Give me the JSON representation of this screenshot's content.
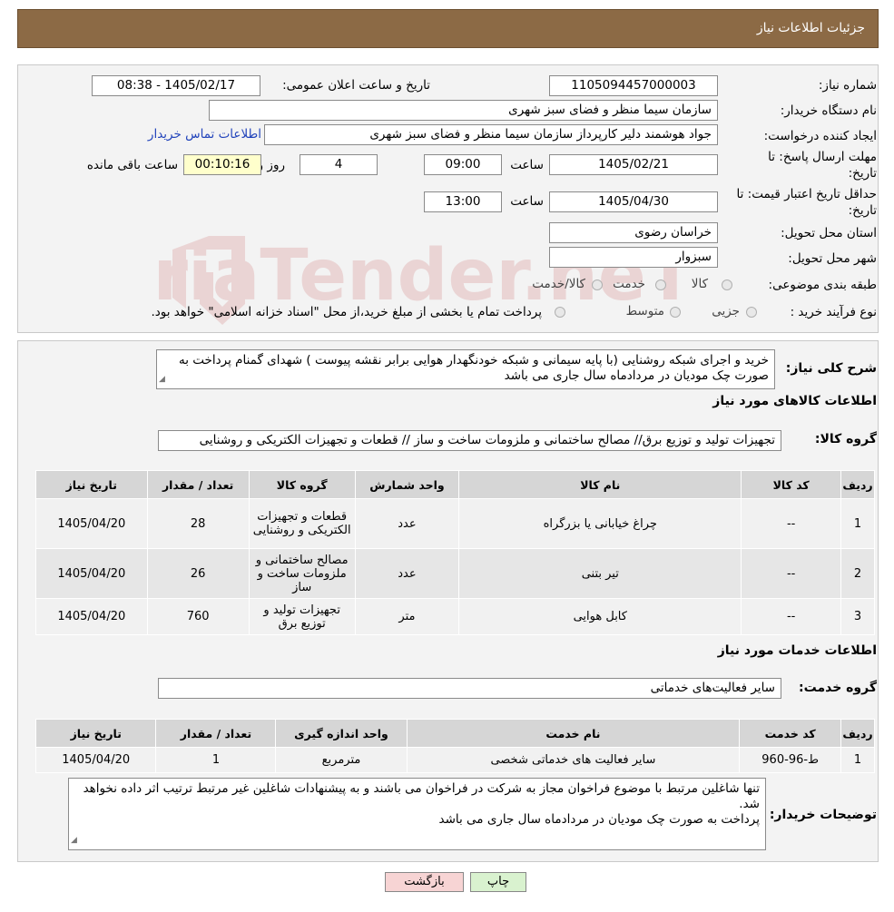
{
  "header": {
    "title": "جزئیات اطلاعات نیاز"
  },
  "info": {
    "need_number_label": "شماره نیاز:",
    "need_number": "1105094457000003",
    "announce_label": "تاریخ و ساعت اعلان عمومی:",
    "announce_value": "1405/02/17 - 08:38",
    "buyer_org_label": "نام دستگاه خریدار:",
    "buyer_org": "سازمان سیما منظر و فضای سبز شهری",
    "creator_label": "ایجاد کننده درخواست:",
    "creator": "جواد هوشمند دلیر کارپرداز سازمان سیما منظر و فضای سبز شهری",
    "contact_link": "اطلاعات تماس خریدار",
    "deadline_label_1": "مهلت ارسال پاسخ: تا",
    "deadline_label_2": "تاریخ:",
    "deadline_date": "1405/02/21",
    "time_label": "ساعت",
    "deadline_time": "09:00",
    "days_value": "4",
    "days_label": "روز و",
    "remaining_time": "00:10:16",
    "remaining_label": "ساعت باقی مانده",
    "validity_label_1": "حداقل تاریخ اعتبار قیمت: تا",
    "validity_label_2": "تاریخ:",
    "validity_date": "1405/04/30",
    "validity_time_label": "ساعت",
    "validity_time": "13:00",
    "province_label": "استان محل تحویل:",
    "province": "خراسان رضوی",
    "city_label": "شهر محل تحویل:",
    "city": "سبزوار",
    "category_label": "طبقه بندی موضوعی:",
    "category_options": [
      "کالا",
      "خدمت",
      "کالا/خدمت"
    ],
    "process_label": "نوع فرآیند خرید :",
    "process_options": [
      "جزیی",
      "متوسط"
    ],
    "process_note": "پرداخت تمام یا بخشی از مبلغ خرید،از محل \"اسناد خزانه اسلامی\" خواهد بود."
  },
  "summary": {
    "label": "شرح کلی نیاز:",
    "text": "خرید و اجرای شبکه روشنایی (با پایه سیمانی و شبکه خودنگهدار هوایی برابر نقشه پیوست ) شهدای گمنام پرداخت به صورت چک مودیان در مردادماه سال جاری می باشد"
  },
  "goods": {
    "section_title": "اطلاعات کالاهای مورد نیاز",
    "group_label": "گروه کالا:",
    "group_value": "تجهیزات تولید و توزیع برق// مصالح ساختمانی و ملزومات ساخت و ساز // قطعات و تجهیزات الکتریکی و روشنایی",
    "headers": [
      "ردیف",
      "کد کالا",
      "نام کالا",
      "واحد شمارش",
      "گروه کالا",
      "تعداد / مقدار",
      "تاریخ نیاز"
    ],
    "rows": [
      {
        "row": "1",
        "code": "--",
        "name": "چراغ خیابانی یا بزرگراه",
        "unit": "عدد",
        "group": "قطعات و تجهیزات الکتریکی و روشنایی",
        "qty": "28",
        "date": "1405/04/20"
      },
      {
        "row": "2",
        "code": "--",
        "name": "تیر بتنی",
        "unit": "عدد",
        "group": "مصالح ساختمانی و ملزومات ساخت و ساز",
        "qty": "26",
        "date": "1405/04/20"
      },
      {
        "row": "3",
        "code": "--",
        "name": "کابل هوایی",
        "unit": "متر",
        "group": "تجهیزات تولید و توزیع برق",
        "qty": "760",
        "date": "1405/04/20"
      }
    ]
  },
  "services": {
    "section_title": "اطلاعات خدمات مورد نیاز",
    "group_label": "گروه خدمت:",
    "group_value": "سایر فعالیت‌های خدماتی",
    "headers": [
      "ردیف",
      "کد خدمت",
      "نام خدمت",
      "واحد اندازه گیری",
      "تعداد / مقدار",
      "تاریخ نیاز"
    ],
    "rows": [
      {
        "row": "1",
        "code": "ط-96-960",
        "name": "سایر فعالیت های خدماتی شخصی",
        "unit": "مترمربع",
        "qty": "1",
        "date": "1405/04/20"
      }
    ]
  },
  "buyer_notes": {
    "label": "توضیحات خریدار:",
    "line1": "تنها شاغلین مرتبط با موضوع فراخوان مجاز به شرکت در فراخوان می باشند و به پیشنهادات شاغلین غیر مرتبط  ترتیب اثر داده نخواهد شد.",
    "line2": "پرداخت به صورت چک مودیان در مردادماه سال جاری می باشد"
  },
  "buttons": {
    "print": "چاپ",
    "back": "بازگشت"
  },
  "colors": {
    "header_bg": "#8c6a45",
    "print_bg": "#d9f2cf",
    "back_bg": "#f7d4d4",
    "link": "#2244bb"
  },
  "watermark": {
    "text": "AriaTender.neT"
  }
}
